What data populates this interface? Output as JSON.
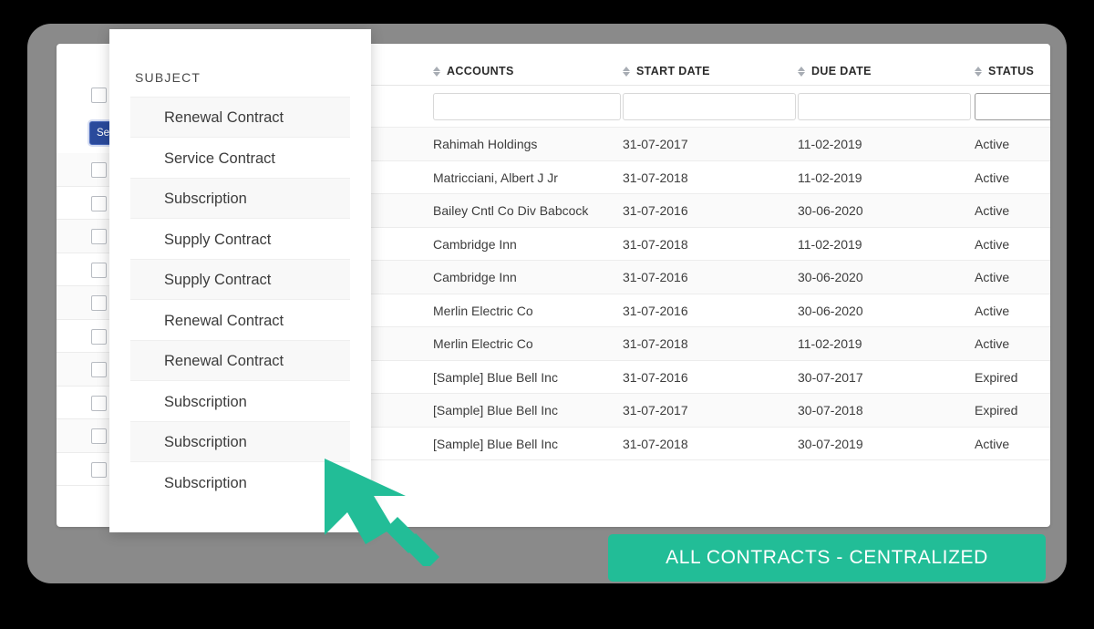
{
  "theme": {
    "accent_teal": "#22bd97",
    "frame_gray": "#8a8a8a",
    "button_blue": "#2a4a9c",
    "row_alt": "#fafafa",
    "text_dark": "#3c3c3c"
  },
  "rail": {
    "select_all_checkbox": "",
    "action_button_label": "Se",
    "row_checkboxes": [
      "",
      "",
      "",
      "",
      "",
      "",
      "",
      "",
      "",
      ""
    ]
  },
  "subject_panel": {
    "title": "SUBJECT",
    "items": [
      {
        "label": "Renewal Contract",
        "shaded": true
      },
      {
        "label": "Service Contract",
        "shaded": false
      },
      {
        "label": "Subscription",
        "shaded": true
      },
      {
        "label": "Supply Contract",
        "shaded": false
      },
      {
        "label": "Supply Contract",
        "shaded": true
      },
      {
        "label": "Renewal Contract",
        "shaded": false
      },
      {
        "label": "Renewal Contract",
        "shaded": true
      },
      {
        "label": "Subscription",
        "shaded": false
      },
      {
        "label": "Subscription",
        "shaded": true
      },
      {
        "label": "Subscription",
        "shaded": false
      }
    ]
  },
  "table": {
    "columns": [
      {
        "key": "accounts",
        "label": "ACCOUNTS",
        "sortable": true
      },
      {
        "key": "start_date",
        "label": "START DATE",
        "sortable": true
      },
      {
        "key": "due_date",
        "label": "DUE DATE",
        "sortable": true
      },
      {
        "key": "status",
        "label": "STATUS",
        "sortable": true
      }
    ],
    "filters": {
      "accounts": "",
      "start_date": "",
      "due_date": "",
      "status": "",
      "focused_field": "status"
    },
    "rows": [
      {
        "accounts": "Rahimah Holdings",
        "start_date": "31-07-2017",
        "due_date": "11-02-2019",
        "status": "Active"
      },
      {
        "accounts": "Matricciani, Albert J Jr",
        "start_date": "31-07-2018",
        "due_date": "11-02-2019",
        "status": "Active"
      },
      {
        "accounts": "Bailey Cntl Co Div Babcock",
        "start_date": "31-07-2016",
        "due_date": "30-06-2020",
        "status": "Active"
      },
      {
        "accounts": "Cambridge Inn",
        "start_date": "31-07-2018",
        "due_date": "11-02-2019",
        "status": "Active"
      },
      {
        "accounts": "Cambridge Inn",
        "start_date": "31-07-2016",
        "due_date": "30-06-2020",
        "status": "Active"
      },
      {
        "accounts": "Merlin Electric Co",
        "start_date": "31-07-2016",
        "due_date": "30-06-2020",
        "status": "Active"
      },
      {
        "accounts": "Merlin Electric Co",
        "start_date": "31-07-2018",
        "due_date": "11-02-2019",
        "status": "Active"
      },
      {
        "accounts": "[Sample] Blue Bell Inc",
        "start_date": "31-07-2016",
        "due_date": "30-07-2017",
        "status": "Expired"
      },
      {
        "accounts": "[Sample] Blue Bell Inc",
        "start_date": "31-07-2017",
        "due_date": "30-07-2018",
        "status": "Expired"
      },
      {
        "accounts": "[Sample] Blue Bell Inc",
        "start_date": "31-07-2018",
        "due_date": "30-07-2019",
        "status": "Active"
      }
    ]
  },
  "cursor": {
    "icon": "arrow-cursor-icon",
    "color": "#22bd97"
  },
  "caption": {
    "text": "ALL CONTRACTS - CENTRALIZED"
  }
}
